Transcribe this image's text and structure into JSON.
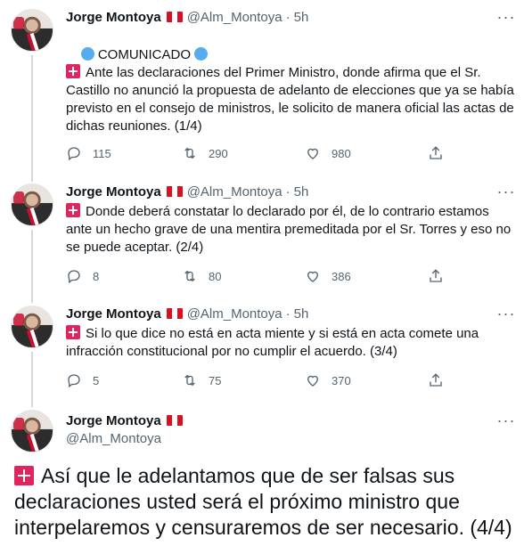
{
  "author": {
    "name": "Jorge Montoya",
    "handle": "@Alm_Montoya",
    "separator": "·"
  },
  "tweets": [
    {
      "time": "5h",
      "line1": "COMUNICADO",
      "body": "Ante las declaraciones del Primer Ministro, donde afirma que el Sr. Castillo no anunció la propuesta de adelanto de elecciones que ya se había previsto en el consejo de ministros, le solicito de manera oficial las actas de dichas reuniones. (1/4)",
      "replies": "115",
      "retweets": "290",
      "likes": "980"
    },
    {
      "time": "5h",
      "body": "Donde deberá constatar lo declarado por él, de lo contrario estamos ante un hecho grave de una mentira premeditada por el Sr. Torres y eso no se puede aceptar. (2/4)",
      "replies": "8",
      "retweets": "80",
      "likes": "386"
    },
    {
      "time": "5h",
      "body": "Si lo que dice no está en acta miente y si está en acta comete una infracción constitucional por no cumplir el acuerdo. (3/4)",
      "replies": "5",
      "retweets": "75",
      "likes": "370"
    },
    {
      "body": "Así que le adelantamos que de ser falsas sus declaraciones usted será el próximo ministro que interpelaremos y censuraremos de ser necesario. (4/4)"
    }
  ],
  "icons": {
    "more": "more-icon",
    "reply": "reply-icon",
    "retweet": "retweet-icon",
    "like": "like-icon",
    "share": "share-icon",
    "siren": "siren-emoji-icon",
    "blue_circle": "blue-circle-emoji-icon",
    "flag": "peru-flag-icon"
  },
  "colors": {
    "text_primary": "#0f1419",
    "text_secondary": "#536471",
    "thread_line": "#cfd9de",
    "blue_circle": "#55acee"
  }
}
